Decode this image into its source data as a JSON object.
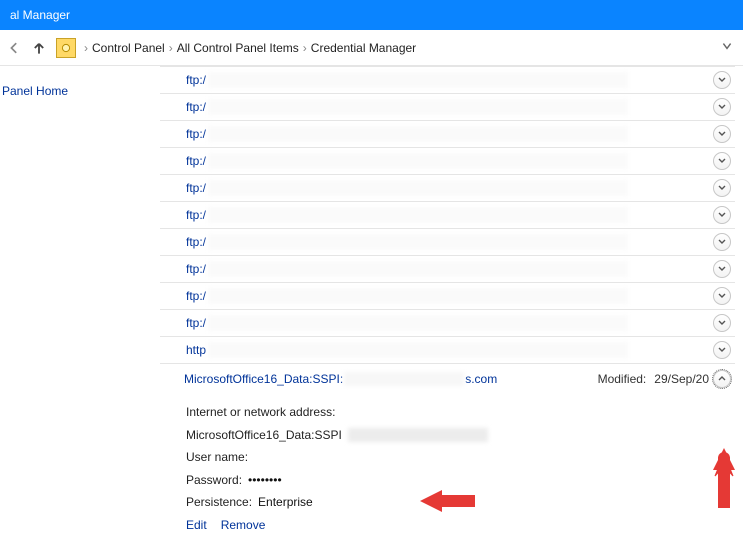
{
  "titlebar": {
    "title": "al Manager"
  },
  "nav": {
    "breadcrumb": [
      "Control Panel",
      "All Control Panel Items",
      "Credential Manager"
    ]
  },
  "sidebar": {
    "home_link": "Panel Home"
  },
  "credentials": [
    {
      "label": "ftp:/"
    },
    {
      "label": "ftp:/"
    },
    {
      "label": "ftp:/"
    },
    {
      "label": "ftp:/"
    },
    {
      "label": "ftp:/"
    },
    {
      "label": "ftp:/"
    },
    {
      "label": "ftp:/"
    },
    {
      "label": "ftp:/"
    },
    {
      "label": "ftp:/"
    },
    {
      "label": "ftp:/"
    },
    {
      "label": "http"
    }
  ],
  "expanded": {
    "name": "MicrosoftOffice16_Data:SSPI:",
    "suffix": "s.com",
    "modified_label": "Modified:",
    "modified_date": "29/Sep/20",
    "detail": {
      "address_label": "Internet or network address:",
      "address_value": "MicrosoftOffice16_Data:SSPI",
      "username_label": "User name:",
      "password_label": "Password:",
      "password_value": "••••••••",
      "persistence_label": "Persistence:",
      "persistence_value": "Enterprise",
      "edit": "Edit",
      "remove": "Remove"
    }
  }
}
